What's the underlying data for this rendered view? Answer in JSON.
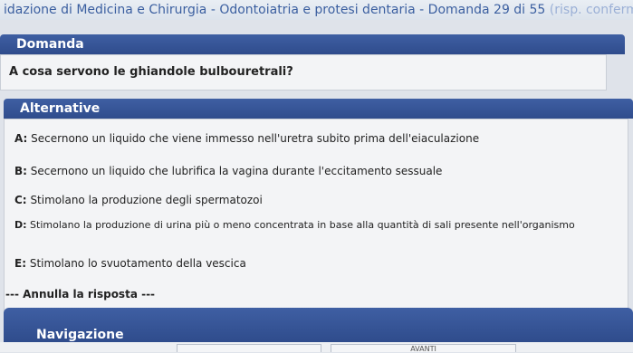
{
  "title_bar": {
    "text": "idazione di Medicina e Chirurgia - Odontoiatria e protesi dentaria - Domanda 29 di 55",
    "faded_suffix": "(risp. confermi"
  },
  "domanda": {
    "header": "Domanda",
    "question": "A cosa servono le ghiandole bulbouretrali?"
  },
  "alternative": {
    "header": "Alternative",
    "items": [
      {
        "letter": "A:",
        "text": "Secernono un liquido che viene immesso nell'uretra subito prima dell'eiaculazione"
      },
      {
        "letter": "B:",
        "text": "Secernono un liquido che lubrifica la vagina durante l'eccitamento sessuale"
      },
      {
        "letter": "C:",
        "text": "Stimolano la produzione degli spermatozoi"
      },
      {
        "letter": "D:",
        "text": "Stimolano la produzione di urina più o meno concentrata in base alla quantità di sali presente nell'organismo"
      },
      {
        "letter": "E:",
        "text": "Stimolano lo svuotamento della vescica"
      }
    ],
    "annulla": "--- Annulla la risposta ---"
  },
  "navigazione": {
    "header": "Navigazione",
    "next_label": "AVANTI"
  },
  "colors": {
    "header_blue": "#2f4c8c",
    "title_blue": "#3b5fa0",
    "panel_bg": "#f3f4f6"
  }
}
